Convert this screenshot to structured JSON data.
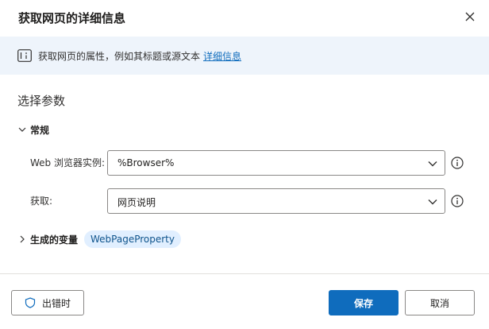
{
  "dialog": {
    "title": "获取网页的详细信息",
    "close_icon": "close-icon"
  },
  "banner": {
    "icon": "info-panel-icon",
    "text": "获取网页的属性，例如其标题或源文本",
    "link": "详细信息"
  },
  "parameters": {
    "section_title": "选择参数",
    "general_group": "常规",
    "fields": [
      {
        "label": "Web 浏览器实例:",
        "value": "%Browser%"
      },
      {
        "label": "获取:",
        "value": "网页说明"
      }
    ]
  },
  "variables": {
    "group_label": "生成的变量",
    "pill": "WebPageProperty"
  },
  "footer": {
    "on_error_label": "出错时",
    "save_label": "保存",
    "cancel_label": "取消"
  },
  "colors": {
    "accent": "#0f6cbd",
    "banner_bg": "#eef4fb",
    "pill_bg": "#e1efff"
  }
}
